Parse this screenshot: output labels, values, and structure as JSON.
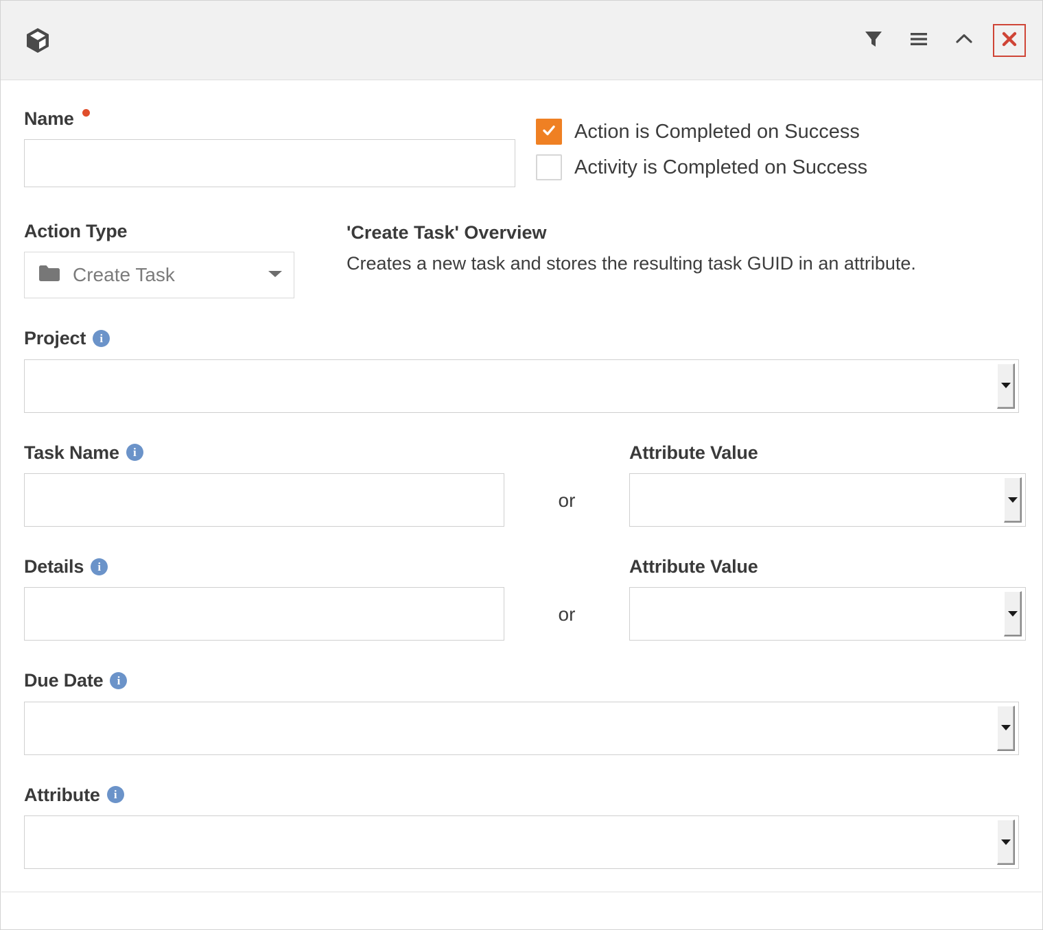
{
  "window": {
    "logo_icon": "box-cube-icon",
    "actions": [
      {
        "name": "filter-button",
        "icon": "filter-icon",
        "label": "Filter"
      },
      {
        "name": "menu-button",
        "icon": "hamburger-menu-icon",
        "label": "Menu"
      },
      {
        "name": "collapse-button",
        "icon": "chevron-up-icon",
        "label": "Collapse"
      },
      {
        "name": "close-button",
        "icon": "close-x-icon",
        "label": "Close"
      }
    ],
    "close_border_color": "#cf4436"
  },
  "colors": {
    "accent_orange": "#ef8023",
    "required_dot": "#e04e2b",
    "info_blue": "#6b93c9",
    "close_red": "#cf4436",
    "titlebar_bg": "#f1f1f1"
  },
  "form": {
    "name": {
      "label": "Name",
      "required": true,
      "value": "",
      "placeholder": ""
    },
    "checkboxes": [
      {
        "label": "Action is Completed on Success",
        "checked": true
      },
      {
        "label": "Activity is Completed on Success",
        "checked": false
      }
    ],
    "action_type": {
      "label": "Action Type",
      "icon": "folder-icon",
      "value": "Create Task",
      "caret": "chevron-down-icon"
    },
    "overview": {
      "title": "'Create Task' Overview",
      "body": "Creates a new task and stores the resulting task GUID in an attribute."
    },
    "project": {
      "label": "Project",
      "info": "info-icon",
      "value": "",
      "placeholder": ""
    },
    "task_name": {
      "label": "Task Name",
      "info": "info-icon",
      "value": "",
      "placeholder": ""
    },
    "task_name_attribute_value": {
      "label": "Attribute Value",
      "value": "",
      "placeholder": ""
    },
    "details": {
      "label": "Details",
      "info": "info-icon",
      "value": "",
      "placeholder": ""
    },
    "details_attribute_value": {
      "label": "Attribute Value",
      "value": "",
      "placeholder": ""
    },
    "or_separator": "or",
    "due_date": {
      "label": "Due Date",
      "info": "info-icon",
      "value": "",
      "placeholder": ""
    },
    "attribute": {
      "label": "Attribute",
      "info": "info-icon",
      "value": "",
      "placeholder": ""
    },
    "info_glyph": "i"
  }
}
